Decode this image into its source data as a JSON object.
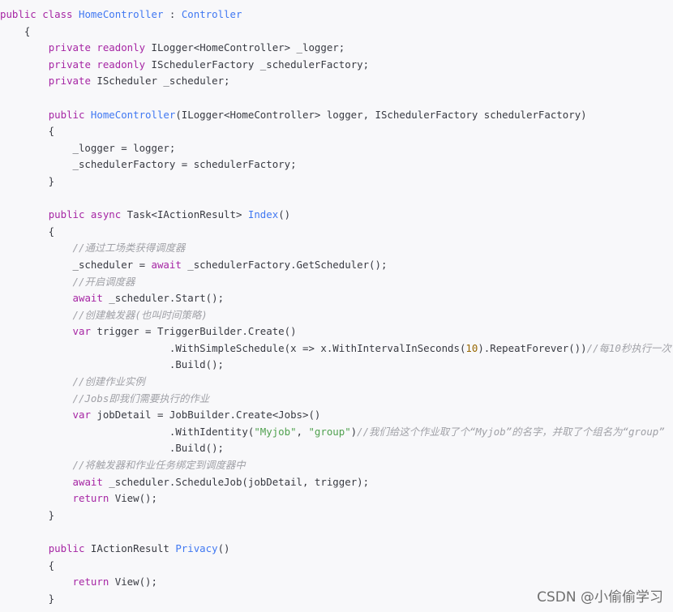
{
  "colors": {
    "background": "#f8f8fa",
    "keyword": "#a626a4",
    "title": "#4078f2",
    "string": "#50a14f",
    "number": "#986801",
    "comment": "#a0a1a7",
    "plain": "#383a42"
  },
  "code": {
    "lines": [
      [
        {
          "c": "kw",
          "t": "public class "
        },
        {
          "c": "title",
          "t": "HomeController"
        },
        {
          "c": "plain",
          "t": " : "
        },
        {
          "c": "title",
          "t": "Controller"
        }
      ],
      [
        {
          "c": "plain",
          "t": "    {"
        }
      ],
      [
        {
          "c": "plain",
          "t": "        "
        },
        {
          "c": "kw",
          "t": "private readonly "
        },
        {
          "c": "plain",
          "t": "ILogger<HomeController> _logger;"
        }
      ],
      [
        {
          "c": "plain",
          "t": "        "
        },
        {
          "c": "kw",
          "t": "private readonly "
        },
        {
          "c": "plain",
          "t": "ISchedulerFactory _schedulerFactory;"
        }
      ],
      [
        {
          "c": "plain",
          "t": "        "
        },
        {
          "c": "kw",
          "t": "private "
        },
        {
          "c": "plain",
          "t": "IScheduler _scheduler;"
        }
      ],
      [
        {
          "c": "plain",
          "t": ""
        }
      ],
      [
        {
          "c": "plain",
          "t": "        "
        },
        {
          "c": "kw",
          "t": "public "
        },
        {
          "c": "title",
          "t": "HomeController"
        },
        {
          "c": "plain",
          "t": "(ILogger<HomeController> logger, ISchedulerFactory schedulerFactory)"
        }
      ],
      [
        {
          "c": "plain",
          "t": "        {"
        }
      ],
      [
        {
          "c": "plain",
          "t": "            _logger = logger;"
        }
      ],
      [
        {
          "c": "plain",
          "t": "            _schedulerFactory = schedulerFactory;"
        }
      ],
      [
        {
          "c": "plain",
          "t": "        }"
        }
      ],
      [
        {
          "c": "plain",
          "t": ""
        }
      ],
      [
        {
          "c": "plain",
          "t": "        "
        },
        {
          "c": "kw",
          "t": "public async "
        },
        {
          "c": "plain",
          "t": "Task<IActionResult> "
        },
        {
          "c": "title",
          "t": "Index"
        },
        {
          "c": "plain",
          "t": "()"
        }
      ],
      [
        {
          "c": "plain",
          "t": "        {"
        }
      ],
      [
        {
          "c": "plain",
          "t": "            "
        },
        {
          "c": "com",
          "t": "//通过工场类获得调度器"
        }
      ],
      [
        {
          "c": "plain",
          "t": "            _scheduler = "
        },
        {
          "c": "kw",
          "t": "await "
        },
        {
          "c": "plain",
          "t": "_schedulerFactory.GetScheduler();"
        }
      ],
      [
        {
          "c": "plain",
          "t": "            "
        },
        {
          "c": "com",
          "t": "//开启调度器"
        }
      ],
      [
        {
          "c": "plain",
          "t": "            "
        },
        {
          "c": "kw",
          "t": "await "
        },
        {
          "c": "plain",
          "t": "_scheduler.Start();"
        }
      ],
      [
        {
          "c": "plain",
          "t": "            "
        },
        {
          "c": "com",
          "t": "//创建触发器(也叫时间策略)"
        }
      ],
      [
        {
          "c": "plain",
          "t": "            "
        },
        {
          "c": "kw",
          "t": "var "
        },
        {
          "c": "plain",
          "t": "trigger = TriggerBuilder.Create()"
        }
      ],
      [
        {
          "c": "plain",
          "t": "                            .WithSimpleSchedule(x => x.WithIntervalInSeconds("
        },
        {
          "c": "num",
          "t": "10"
        },
        {
          "c": "plain",
          "t": ").RepeatForever())"
        },
        {
          "c": "com",
          "t": "//每10秒执行一次"
        }
      ],
      [
        {
          "c": "plain",
          "t": "                            .Build();"
        }
      ],
      [
        {
          "c": "plain",
          "t": "            "
        },
        {
          "c": "com",
          "t": "//创建作业实例"
        }
      ],
      [
        {
          "c": "plain",
          "t": "            "
        },
        {
          "c": "com",
          "t": "//Jobs即我们需要执行的作业"
        }
      ],
      [
        {
          "c": "plain",
          "t": "            "
        },
        {
          "c": "kw",
          "t": "var "
        },
        {
          "c": "plain",
          "t": "jobDetail = JobBuilder.Create<Jobs>()"
        }
      ],
      [
        {
          "c": "plain",
          "t": "                            .WithIdentity("
        },
        {
          "c": "str",
          "t": "\"Myjob\""
        },
        {
          "c": "plain",
          "t": ", "
        },
        {
          "c": "str",
          "t": "\"group\""
        },
        {
          "c": "plain",
          "t": ")"
        },
        {
          "c": "com",
          "t": "//我们给这个作业取了个“Myjob”的名字，并取了个组名为“group”"
        }
      ],
      [
        {
          "c": "plain",
          "t": "                            .Build();"
        }
      ],
      [
        {
          "c": "plain",
          "t": "            "
        },
        {
          "c": "com",
          "t": "//将触发器和作业任务绑定到调度器中"
        }
      ],
      [
        {
          "c": "plain",
          "t": "            "
        },
        {
          "c": "kw",
          "t": "await "
        },
        {
          "c": "plain",
          "t": "_scheduler.ScheduleJob(jobDetail, trigger);"
        }
      ],
      [
        {
          "c": "plain",
          "t": "            "
        },
        {
          "c": "kw",
          "t": "return "
        },
        {
          "c": "plain",
          "t": "View();"
        }
      ],
      [
        {
          "c": "plain",
          "t": "        }"
        }
      ],
      [
        {
          "c": "plain",
          "t": ""
        }
      ],
      [
        {
          "c": "plain",
          "t": "        "
        },
        {
          "c": "kw",
          "t": "public "
        },
        {
          "c": "plain",
          "t": "IActionResult "
        },
        {
          "c": "title",
          "t": "Privacy"
        },
        {
          "c": "plain",
          "t": "()"
        }
      ],
      [
        {
          "c": "plain",
          "t": "        {"
        }
      ],
      [
        {
          "c": "plain",
          "t": "            "
        },
        {
          "c": "kw",
          "t": "return "
        },
        {
          "c": "plain",
          "t": "View();"
        }
      ],
      [
        {
          "c": "plain",
          "t": "        }"
        }
      ]
    ]
  },
  "watermark": {
    "text": "CSDN @小偷偷学习"
  }
}
